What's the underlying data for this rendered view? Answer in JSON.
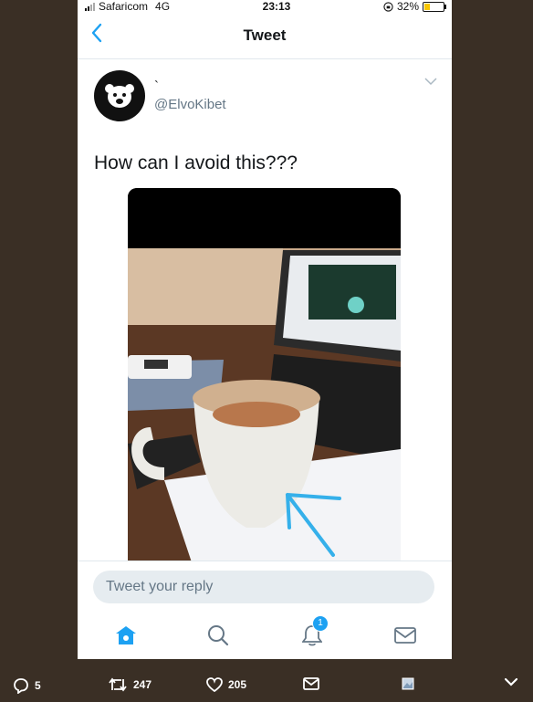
{
  "statusbar": {
    "carrier": "Safaricom",
    "network": "4G",
    "time": "23:13",
    "battery": "32%",
    "battery_level": 0.32
  },
  "navbar": {
    "title": "Tweet"
  },
  "tweet": {
    "display_name": "`",
    "handle": "@ElvoKibet",
    "text": "How can I avoid this???"
  },
  "reply": {
    "placeholder": "Tweet your reply"
  },
  "tabbar": {
    "notification_count": "1"
  },
  "bottom_actions": {
    "replies": "5",
    "retweets": "247",
    "likes": "205"
  },
  "colors": {
    "accent": "#1da1f2",
    "background": "#3a2f25"
  }
}
